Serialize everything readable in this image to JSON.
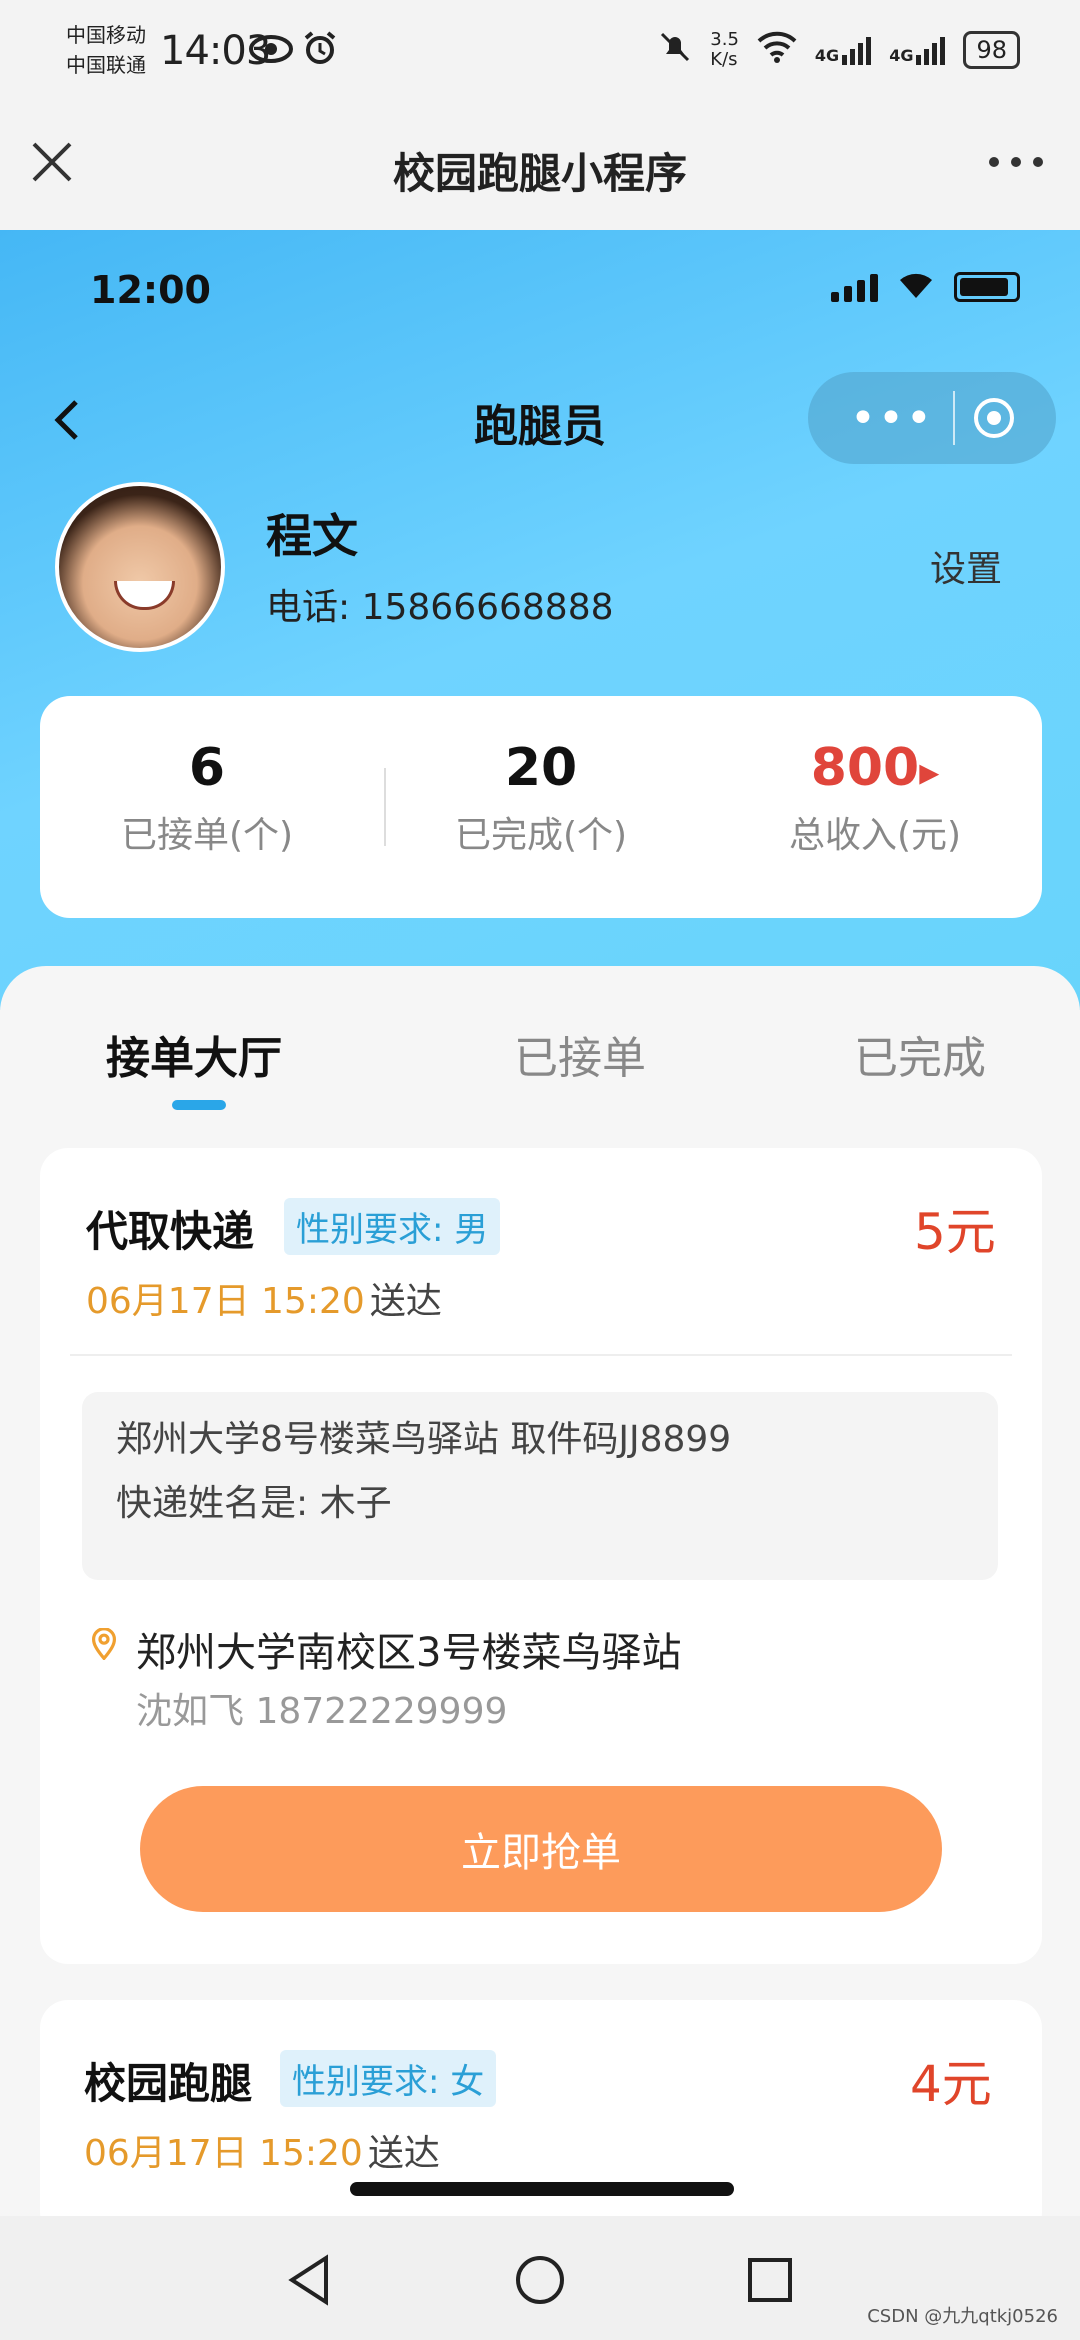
{
  "status_bar": {
    "carrier1": "中国移动",
    "carrier2": "中国联通",
    "time": "14:03",
    "net_speed_top": "3.5",
    "net_speed_bottom": "K/s",
    "network1": "4G",
    "network2": "4G",
    "battery": "98"
  },
  "wechat_bar": {
    "title": "校园跑腿小程序",
    "more_label": "···"
  },
  "mini_status": {
    "time": "12:00"
  },
  "mini_nav": {
    "back": "<",
    "title": "跑腿员"
  },
  "profile": {
    "name": "程文",
    "phone": "电话: 15866668888",
    "settings": "设置"
  },
  "stats": [
    {
      "value": "6",
      "label": "已接单(个)"
    },
    {
      "value": "20",
      "label": "已完成(个)"
    },
    {
      "value": "800",
      "label": "总收入(元)",
      "arrow": "▸"
    }
  ],
  "tabs": [
    {
      "label": "接单大厅",
      "active": true
    },
    {
      "label": "已接单",
      "active": false
    },
    {
      "label": "已完成",
      "active": false
    }
  ],
  "orders": [
    {
      "title": "代取快递",
      "tag": "性别要求: 男",
      "price": "5元",
      "deadline": "06月17日 15:20",
      "deadline_suffix": "送达",
      "detail_line1": "郑州大学8号楼菜鸟驿站 取件码JJ8899",
      "detail_line2": "快递姓名是: 木子",
      "address": "郑州大学南校区3号楼菜鸟驿站",
      "contact": "沈如飞 18722229999",
      "button": "立即抢单"
    },
    {
      "title": "校园跑腿",
      "tag": "性别要求: 女",
      "price": "4元",
      "deadline": "06月17日 15:20",
      "deadline_suffix": "送达"
    }
  ],
  "watermark": "CSDN @九九qtkj0526",
  "colors": {
    "header_blue": "#45b7f5",
    "accent_orange": "#fd9b5b",
    "price_red": "#e0452a",
    "tab_underline": "#2aa6e8"
  }
}
